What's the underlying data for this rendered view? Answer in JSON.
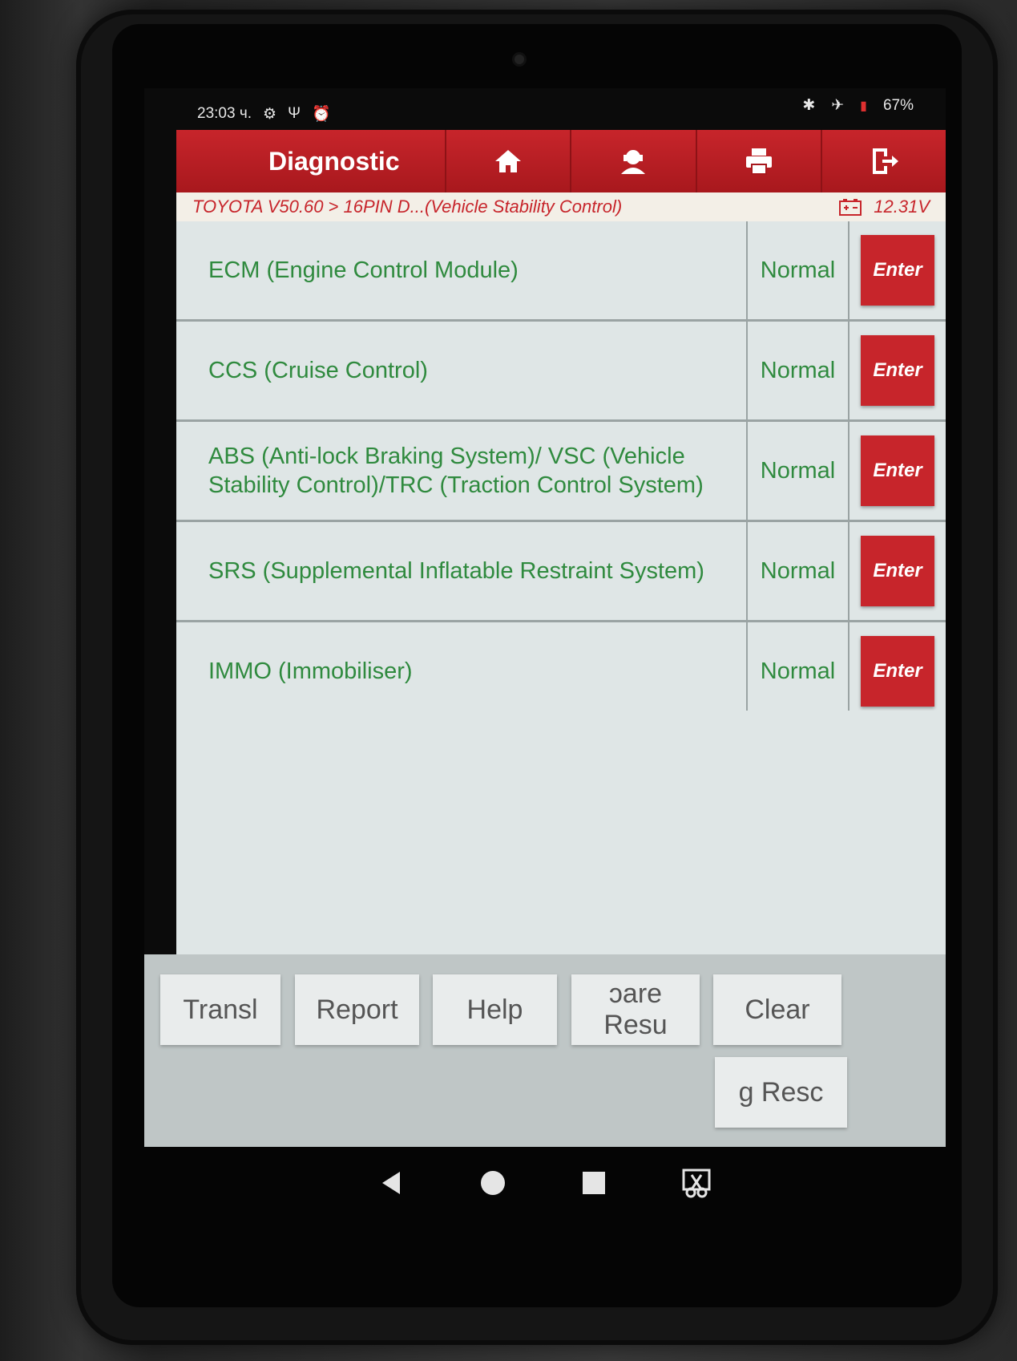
{
  "status_bar": {
    "time": "23:03 ч.",
    "battery": "67%"
  },
  "header": {
    "title": "Diagnostic",
    "buttons": [
      {
        "icon": "home-icon"
      },
      {
        "icon": "support-icon"
      },
      {
        "icon": "print-icon"
      },
      {
        "icon": "exit-icon"
      }
    ]
  },
  "breadcrumb": {
    "path": "TOYOTA V50.60 > 16PIN D...(Vehicle Stability Control)",
    "voltage": "12.31V"
  },
  "systems": [
    {
      "name": "ECM (Engine Control Module)",
      "status": "Normal",
      "action": "Enter"
    },
    {
      "name": "CCS (Cruise Control)",
      "status": "Normal",
      "action": "Enter"
    },
    {
      "name": "ABS (Anti-lock Braking System)/ VSC (Vehicle Stability Control)/TRC (Traction Control System)",
      "status": "Normal",
      "action": "Enter"
    },
    {
      "name": "SRS (Supplemental Inflatable Restraint System)",
      "status": "Normal",
      "action": "Enter"
    },
    {
      "name": "IMMO (Immobiliser)",
      "status": "Normal",
      "action": "Enter"
    }
  ],
  "toolbar": {
    "translate": "Transl",
    "report": "Report",
    "help": "Help",
    "compare": "ɔare Resu",
    "clear": "Clear",
    "rescue": "g    Resc"
  },
  "colors": {
    "header_red": "#c7252b",
    "text_green": "#2f8a3e",
    "list_bg": "#dfe6e6"
  }
}
